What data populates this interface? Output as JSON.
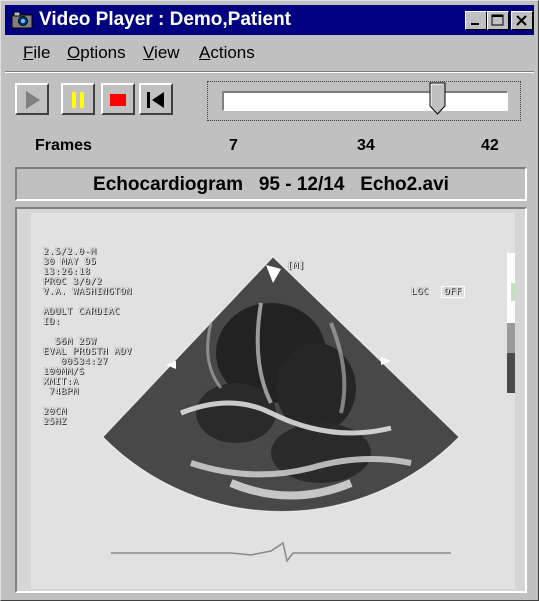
{
  "window": {
    "title": "Video Player : Demo,Patient"
  },
  "menu": {
    "items": [
      {
        "label": "File",
        "accel": "F",
        "rest": "ile"
      },
      {
        "label": "Options",
        "accel": "O",
        "rest": "ptions"
      },
      {
        "label": "View",
        "accel": "V",
        "rest": "iew"
      },
      {
        "label": "Actions",
        "accel": "A",
        "rest": "ctions"
      }
    ]
  },
  "controls": {
    "icons": [
      "play-icon",
      "pause-icon",
      "stop-icon",
      "rewind-icon"
    ],
    "stop_color": "#ff0000",
    "pause_color": "#ffff00"
  },
  "slider": {
    "position": 34,
    "min": 7,
    "max": 42
  },
  "frames": {
    "label": "Frames",
    "start": "7",
    "current": "34",
    "end": "42"
  },
  "caption": {
    "text": "Echocardiogram   95 - 12/14   Echo2.avi"
  },
  "video": {
    "overlay_left": "2.5/2.0-M\n30 MAY 95\n13:26:18\nPROC 3/0/2\nV.A. WASHINGTON\n\nADULT CARDIAC\nID:\n\n  56M 25W\nEVAL PROSTH ADV\n   00534:27\n100MM/S\nXMIT:A\n 74BPM\n\n20CM\n25HZ",
    "overlay_label": "LGC",
    "overlay_value": "OFF",
    "overlay_top": "[M]"
  }
}
